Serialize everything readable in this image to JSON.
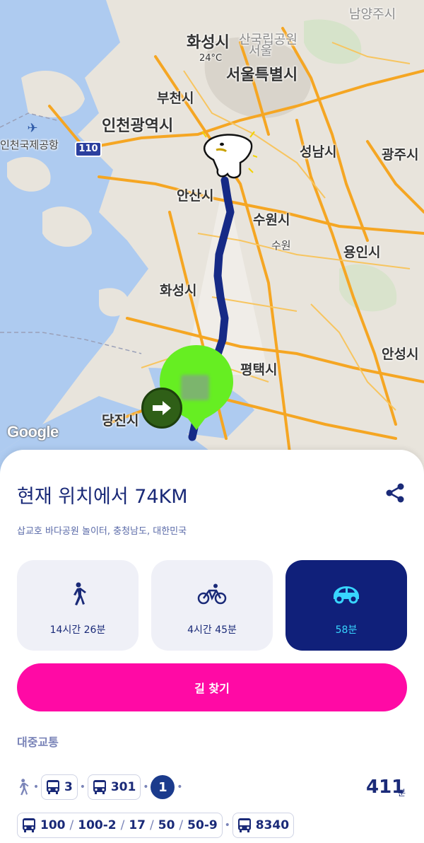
{
  "map": {
    "labels": {
      "namyangju": "남양주시",
      "hwaseong_top": "화성시",
      "bukhansan": "산국립공원",
      "seoul_small": "서울",
      "temp": "24°C",
      "seoul": "서울특별시",
      "bucheon": "부천시",
      "incheon": "인천광역시",
      "incheon_faint": "인천",
      "airport": "인천국제공항",
      "highway": "110",
      "seongnam": "성남시",
      "gwangju": "광주시",
      "ansan": "안산시",
      "suwon_si": "수원시",
      "suwon": "수원",
      "yongin": "용인시",
      "hwaseong": "화성시",
      "pyeongtaek": "평택시",
      "anseong": "안성시",
      "dangjin": "당진시"
    },
    "attribution": "Google",
    "icons": {
      "mascot": "mascot-character-icon",
      "start": "start-location-pin-icon",
      "direction": "direction-arrow-icon",
      "airport": "airplane-icon"
    }
  },
  "sheet": {
    "title": "현재 위치에서 74KM",
    "subtitle": "삽교호 바다공원 놀이터, 충청남도, 대한민국",
    "share_icon": "share-icon",
    "modes": [
      {
        "icon": "walk-icon",
        "time": "14시간 26분",
        "active": false
      },
      {
        "icon": "bike-icon",
        "time": "4시간 45분",
        "active": false
      },
      {
        "icon": "car-icon",
        "time": "58분",
        "active": true
      }
    ],
    "route_button": "길 찾기",
    "transit_heading": "대중교통",
    "transit": {
      "row1": {
        "walk_icon": "walk-icon",
        "bus1": "3",
        "bus2": "301",
        "line": "1"
      },
      "row2": {
        "bus_a": [
          "100",
          "100-2",
          "17",
          "50",
          "50-9"
        ],
        "bus_b": "8340"
      },
      "total": "411",
      "total_unit": "분"
    }
  },
  "colors": {
    "accent_pink": "#ff0aa5",
    "navy": "#10207a",
    "car_cyan": "#38d6ff",
    "route": "#1a2a8a",
    "start_green": "#66ee22"
  }
}
